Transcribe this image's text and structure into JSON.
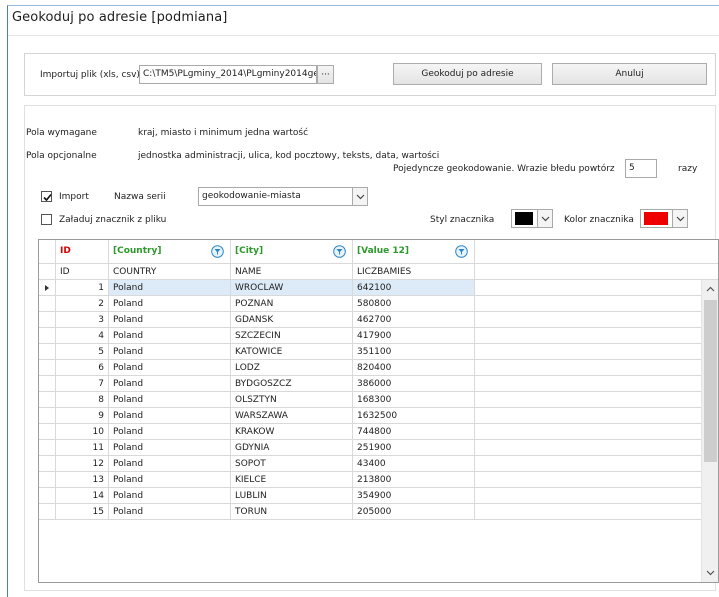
{
  "window": {
    "title": "Geokoduj po adresie  [podmiana]"
  },
  "import_bar": {
    "label": "Importuj plik (xls, csv)",
    "file_path": "C:\\TM5\\PLgminy_2014\\PLgminy2014ge",
    "browse_label": "···",
    "geocode_button": "Geokoduj po adresie",
    "cancel_button": "Anuluj"
  },
  "fields_info": {
    "required_label": "Pola wymagane",
    "required_value": "kraj, miasto i minimum jedna wartość",
    "optional_label": "Pola opcjonalne",
    "optional_value": "jednostka administracji, ulica, kod pocztowy, teksts, data, wartości"
  },
  "retry": {
    "label": "Pojedyncze geokodowanie. Wrazie błedu powtórz",
    "value": "5",
    "suffix": "razy"
  },
  "options": {
    "import_label": "Import",
    "import_checked": true,
    "series_label": "Nazwa serii",
    "series_value": "geokodowanie-miasta",
    "load_marker_label": "Załaduj znacznik z pliku",
    "load_marker_checked": false,
    "marker_style_label": "Styl znacznika",
    "marker_style_color": "#000000",
    "marker_color_label": "Kolor znacznika",
    "marker_color": "#ee0000"
  },
  "grid": {
    "headers": [
      {
        "text": "ID",
        "color": "red",
        "filter": false
      },
      {
        "text": "[Country]",
        "color": "green",
        "filter": true
      },
      {
        "text": "[City]",
        "color": "green",
        "filter": true
      },
      {
        "text": "[Value 12]",
        "color": "green",
        "filter": true
      }
    ],
    "source_columns": [
      "ID",
      "COUNTRY",
      "NAME",
      "LICZBAMIES"
    ],
    "rows": [
      [
        "1",
        "Poland",
        "WROCLAW",
        "642100"
      ],
      [
        "2",
        "Poland",
        "POZNAN",
        "580800"
      ],
      [
        "3",
        "Poland",
        "GDANSK",
        "462700"
      ],
      [
        "4",
        "Poland",
        "SZCZECIN",
        "417900"
      ],
      [
        "5",
        "Poland",
        "KATOWICE",
        "351100"
      ],
      [
        "6",
        "Poland",
        "LODZ",
        "820400"
      ],
      [
        "7",
        "Poland",
        "BYDGOSZCZ",
        "386000"
      ],
      [
        "8",
        "Poland",
        "OLSZTYN",
        "168300"
      ],
      [
        "9",
        "Poland",
        "WARSZAWA",
        "1632500"
      ],
      [
        "10",
        "Poland",
        "KRAKOW",
        "744800"
      ],
      [
        "11",
        "Poland",
        "GDYNIA",
        "251900"
      ],
      [
        "12",
        "Poland",
        "SOPOT",
        "43400"
      ],
      [
        "13",
        "Poland",
        "KIELCE",
        "213800"
      ],
      [
        "14",
        "Poland",
        "LUBLIN",
        "354900"
      ],
      [
        "15",
        "Poland",
        "TORUN",
        "205000"
      ]
    ],
    "selected_row": 0
  }
}
